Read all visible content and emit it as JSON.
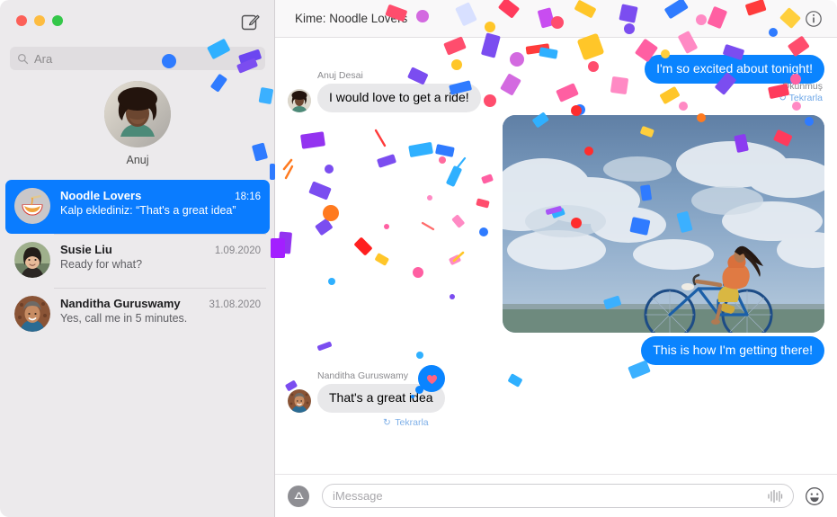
{
  "window": {
    "traffic_lights": [
      "close",
      "minimize",
      "maximize"
    ],
    "close_color": "#fc6058",
    "minimize_color": "#fdbc40",
    "maximize_color": "#34c749"
  },
  "sidebar": {
    "compose_icon": "compose-pencil-square-icon",
    "search": {
      "icon": "search-icon",
      "placeholder": "Ara",
      "value": ""
    },
    "contact_card": {
      "name": "Anuj",
      "avatar": "anuj-avatar"
    },
    "conversations": [
      {
        "title": "Noodle Lovers",
        "time": "18:16",
        "preview": "Kalp eklediniz: “That's a great idea”",
        "avatar": "noodle-bowl-avatar",
        "selected": true
      },
      {
        "title": "Susie Liu",
        "time": "1.09.2020",
        "preview": "Ready for what?",
        "avatar": "susie-liu-avatar",
        "selected": false
      },
      {
        "title": "Nanditha Guruswamy",
        "time": "31.08.2020",
        "preview": "Yes, call me in 5 minutes.",
        "avatar": "nanditha-guruswamy-avatar",
        "selected": false
      }
    ]
  },
  "conversation": {
    "header": {
      "title": "Kime: Noodle Lovers",
      "info_icon": "info-circle-icon"
    },
    "messages": [
      {
        "id": "msg-anuj",
        "sender": "Anuj Desai",
        "text": "I would love to get a ride!",
        "direction": "incoming"
      },
      {
        "id": "msg-excited",
        "text": "I'm so excited about tonight!",
        "direction": "outgoing",
        "status": "Okunmuş",
        "replay": "Tekrarla",
        "replay_icon": "replay-arrow-icon"
      },
      {
        "id": "msg-photo",
        "direction": "outgoing",
        "attachment": "bicycle-rider-sky-photo"
      },
      {
        "id": "msg-getting-there",
        "text": "This is how I'm getting there!",
        "direction": "outgoing"
      },
      {
        "id": "msg-great-idea",
        "sender": "Nanditha Guruswamy",
        "text": "That's a great idea",
        "direction": "incoming",
        "reaction": "heart-reaction",
        "reaction_color": "#ff6482",
        "replay": "Tekrarla",
        "replay_icon": "replay-arrow-icon"
      }
    ],
    "input_bar": {
      "apps_icon": "app-store-icon",
      "placeholder": "iMessage",
      "value": "",
      "audio_icon": "audio-waveform-icon",
      "emoji_icon": "emoji-smiley-icon"
    }
  },
  "colors": {
    "accent_blue": "#0a84ff",
    "selected_row": "#0a7cff",
    "incoming_bubble": "#e8e8ea",
    "sidebar_bg": "#eceaec"
  },
  "effect": {
    "name": "confetti-screen-effect"
  }
}
